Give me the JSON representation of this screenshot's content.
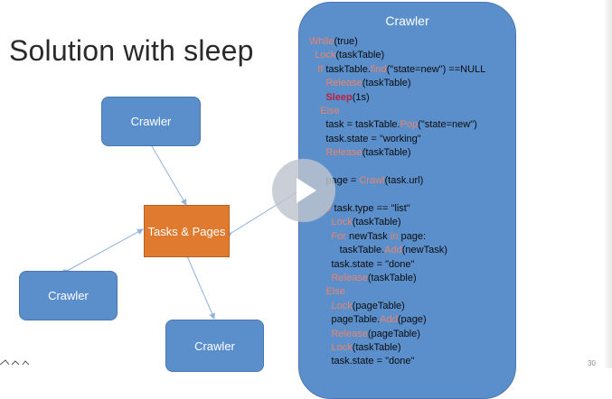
{
  "slide": {
    "title": "Solution with sleep",
    "slide_number": "30"
  },
  "diagram": {
    "crawler_top": "Crawler",
    "hub": "Tasks & Pages",
    "crawler_left": "Crawler",
    "crawler_bottom": "Crawler"
  },
  "panel": {
    "title": "Crawler",
    "code": [
      {
        "indent": "",
        "parts": [
          {
            "t": "While",
            "k": true
          },
          {
            "t": "(true)"
          }
        ]
      },
      {
        "indent": "  ",
        "parts": [
          {
            "t": "Lock",
            "k": true
          },
          {
            "t": "(taskTable)"
          }
        ]
      },
      {
        "indent": "   ",
        "parts": [
          {
            "t": "If",
            "k": true
          },
          {
            "t": " taskTable."
          },
          {
            "t": "find",
            "k": true
          },
          {
            "t": "(\"state=new\") ==NULL"
          }
        ]
      },
      {
        "indent": "      ",
        "parts": [
          {
            "t": "Release",
            "k": true
          },
          {
            "t": "(taskTable)"
          }
        ]
      },
      {
        "indent": "      ",
        "parts": [
          {
            "t": "Sleep",
            "s": true
          },
          {
            "t": "(1s)"
          }
        ]
      },
      {
        "indent": "    ",
        "parts": [
          {
            "t": "Else",
            "k": true
          }
        ]
      },
      {
        "indent": "      ",
        "parts": [
          {
            "t": "task = taskTable."
          },
          {
            "t": "Pop",
            "k": true
          },
          {
            "t": "(\"state=new\")"
          }
        ]
      },
      {
        "indent": "      ",
        "parts": [
          {
            "t": "task.state = \"working\""
          }
        ]
      },
      {
        "indent": "      ",
        "parts": [
          {
            "t": "Release",
            "k": true
          },
          {
            "t": "(taskTable)"
          }
        ]
      },
      {
        "indent": "",
        "parts": [
          {
            "t": " "
          }
        ]
      },
      {
        "indent": "      ",
        "parts": [
          {
            "t": "page = "
          },
          {
            "t": "Crawl",
            "k": true
          },
          {
            "t": "(task.url)"
          }
        ]
      },
      {
        "indent": "",
        "parts": [
          {
            "t": " "
          }
        ]
      },
      {
        "indent": "      ",
        "parts": [
          {
            "t": "If",
            "k": true
          },
          {
            "t": " task.type == \"list\""
          }
        ]
      },
      {
        "indent": "        ",
        "parts": [
          {
            "t": "Lock",
            "k": true
          },
          {
            "t": "(taskTable)"
          }
        ]
      },
      {
        "indent": "        ",
        "parts": [
          {
            "t": "For",
            "k": true
          },
          {
            "t": " newTask "
          },
          {
            "t": "in",
            "k": true
          },
          {
            "t": " page:"
          }
        ]
      },
      {
        "indent": "           ",
        "parts": [
          {
            "t": "taskTable."
          },
          {
            "t": "Add",
            "k": true
          },
          {
            "t": "(newTask)"
          }
        ]
      },
      {
        "indent": "        ",
        "parts": [
          {
            "t": "task.state = \"done\""
          }
        ]
      },
      {
        "indent": "        ",
        "parts": [
          {
            "t": "Release",
            "k": true
          },
          {
            "t": "(taskTable)"
          }
        ]
      },
      {
        "indent": "      ",
        "parts": [
          {
            "t": "Else",
            "k": true
          }
        ]
      },
      {
        "indent": "        ",
        "parts": [
          {
            "t": "Lock",
            "k": true
          },
          {
            "t": "(pageTable)"
          }
        ]
      },
      {
        "indent": "        ",
        "parts": [
          {
            "t": "pageTable."
          },
          {
            "t": "Add",
            "k": true
          },
          {
            "t": "(page)"
          }
        ]
      },
      {
        "indent": "        ",
        "parts": [
          {
            "t": "Release",
            "k": true
          },
          {
            "t": "(pageTable)"
          }
        ]
      },
      {
        "indent": "        ",
        "parts": [
          {
            "t": "Lock",
            "k": true
          },
          {
            "t": "(taskTable)"
          }
        ]
      },
      {
        "indent": "        ",
        "parts": [
          {
            "t": "task.state = \"done\""
          }
        ]
      }
    ]
  },
  "video": {
    "control_icon": "play-icon"
  },
  "colors": {
    "box_blue": "#5b8fcc",
    "hub_orange": "#e07a2e",
    "keyword": "#e9846a",
    "sleep": "#b8223f"
  }
}
